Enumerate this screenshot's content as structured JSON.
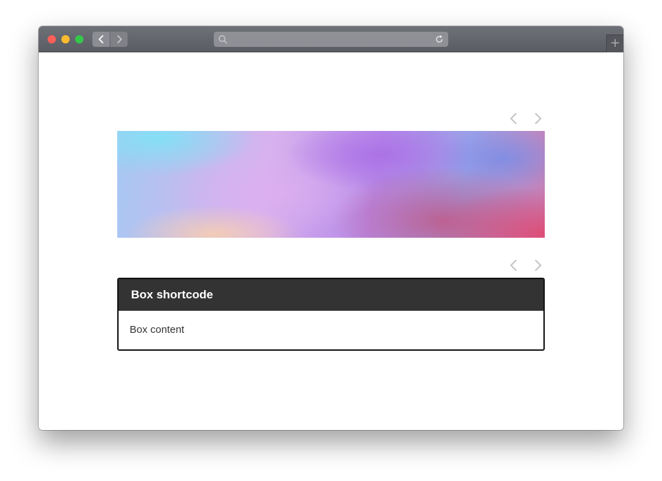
{
  "browser": {
    "address_value": "",
    "new_tab_symbol": "+",
    "icons": {
      "back": "chevron-left-icon",
      "forward": "chevron-right-icon",
      "search": "search-icon",
      "reload": "reload-icon"
    },
    "colors": {
      "close": "#fc5f57",
      "minimize": "#fdbc2e",
      "zoom": "#34c84a",
      "titlebar": "#5f6167"
    }
  },
  "slider": {
    "prev_icon": "chevron-left-icon",
    "next_icon": "chevron-right-icon",
    "arrow_color": "#c7c7c7"
  },
  "box": {
    "title": "Box shortcode",
    "content": "Box content",
    "header_color": "#333333",
    "border_color": "#111111"
  }
}
